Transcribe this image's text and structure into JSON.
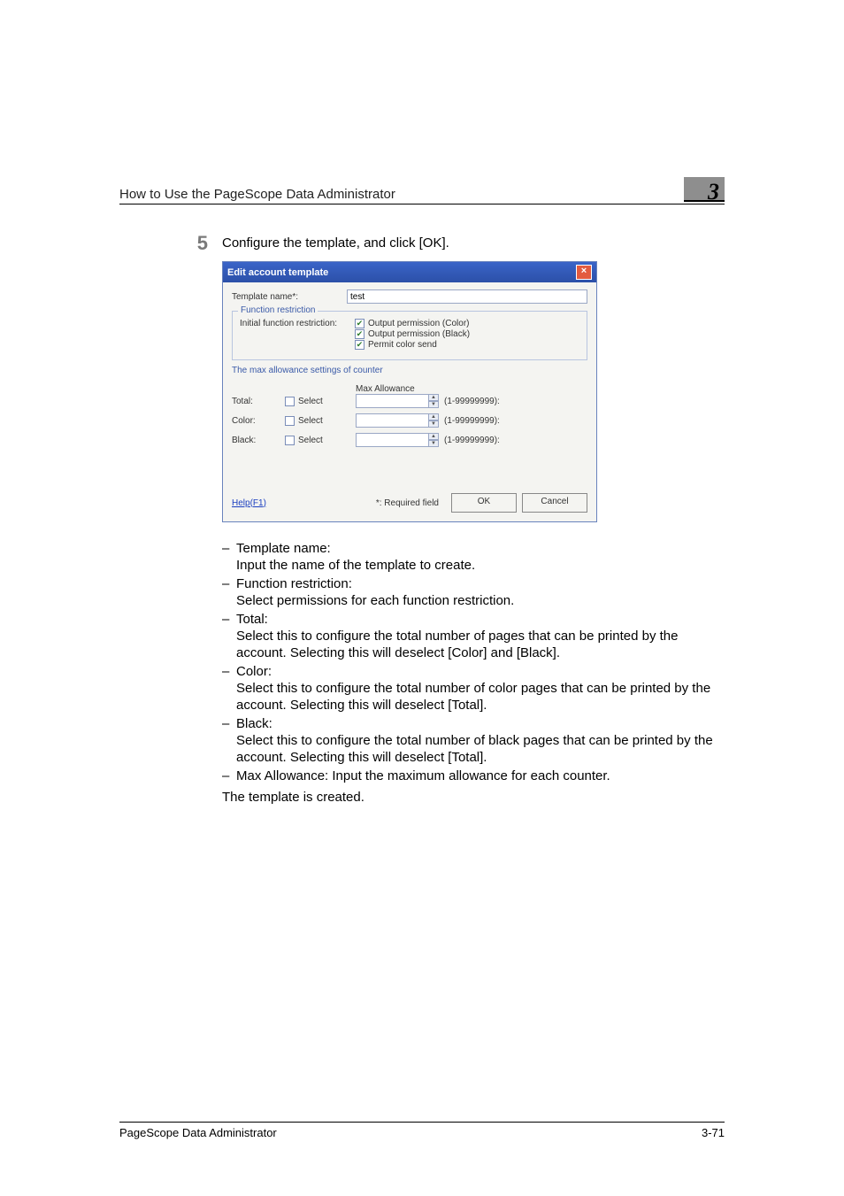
{
  "header": {
    "title": "How to Use the PageScope Data Administrator",
    "chapter": "3"
  },
  "step": {
    "num": "5",
    "text": "Configure the template, and click [OK]."
  },
  "dialog": {
    "title": "Edit account template",
    "template_name_label": "Template name*:",
    "template_name_value": "test",
    "func_restriction_group": "Function restriction",
    "initial_restriction_label": "Initial function restriction:",
    "perm1": "Output permission (Color)",
    "perm2": "Output permission (Black)",
    "perm3": "Permit color send",
    "max_settings_heading": "The max allowance settings of counter",
    "max_allowance_label": "Max Allowance",
    "total_label": "Total:",
    "color_label": "Color:",
    "black_label": "Black:",
    "select_label": "Select",
    "range": "(1-99999999):",
    "help": "Help(F1)",
    "required": "*: Required field",
    "ok": "OK",
    "cancel": "Cancel"
  },
  "desc": {
    "i0h": "Template name:",
    "i0b": "Input the name of the template to create.",
    "i1h": "Function restriction:",
    "i1b": "Select permissions for each function restriction.",
    "i2h": "Total:",
    "i2b": "Select this to configure the total number of pages that can be printed by the account. Selecting this will deselect [Color] and [Black].",
    "i3h": "Color:",
    "i3b": "Select this to configure the total number of color pages that can be printed by the account. Selecting this will deselect [Total].",
    "i4h": "Black:",
    "i4b": "Select this to configure the total number of black pages that can be printed by the account. Selecting this will deselect [Total].",
    "i5h": "Max Allowance: Input the maximum allowance for each counter.",
    "final": "The template is created."
  },
  "footer": {
    "title": "PageScope Data Administrator",
    "page": "3-71"
  }
}
